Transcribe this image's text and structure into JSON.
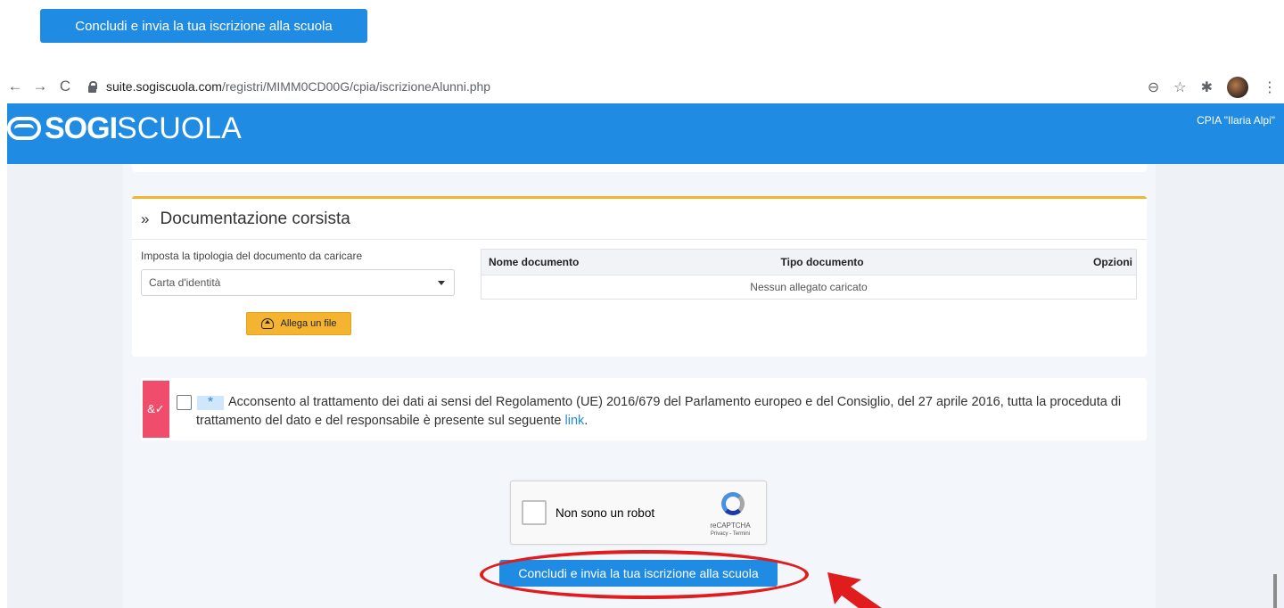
{
  "callout": {
    "label": "Concludi e invia la tua iscrizione alla scuola"
  },
  "browser": {
    "url_host": "suite.sogiscuola.com",
    "url_path": "/registri/MIMM0CD00G/cpia/iscrizioneAlunni.php",
    "back_icon": "←",
    "forward_icon": "→",
    "reload_icon": "C",
    "zoom_icon": "⊖",
    "star_icon": "☆",
    "extensions_icon": "✱",
    "menu_icon": "⋮"
  },
  "header": {
    "logo_bold": "SOGI",
    "logo_light": "SCUOLA",
    "school": "CPIA \"Ilaria Alpi\""
  },
  "documentation": {
    "title": "Documentazione corsista",
    "chevron": "»",
    "type_label": "Imposta la tipologia del documento da caricare",
    "selected_type": "Carta d'identità",
    "attach_label": "Allega un file",
    "table": {
      "headers": [
        "Nome documento",
        "Tipo documento",
        "Opzioni"
      ],
      "empty": "Nessun allegato caricato"
    }
  },
  "consent": {
    "required_mark": "*",
    "strip_icon": "&✓",
    "text": "Acconsento al trattamento dei dati ai sensi del Regolamento (UE) 2016/679 del Parlamento europeo e del Consiglio, del 27 aprile 2016, tutta la proceduta di trattamento del dato e del responsabile è presente sul seguente",
    "link": "link",
    "end": "."
  },
  "recaptcha": {
    "label": "Non sono un robot",
    "brand": "reCAPTCHA",
    "terms": "Privacy - Termini"
  },
  "submit": {
    "label": "Concludi e invia la tua iscrizione alla scuola"
  },
  "colors": {
    "brand_blue": "#1f8be3",
    "accent_yellow": "#f4b431",
    "consent_pink": "#f04d6c",
    "annotation_red": "#e01c1c"
  }
}
